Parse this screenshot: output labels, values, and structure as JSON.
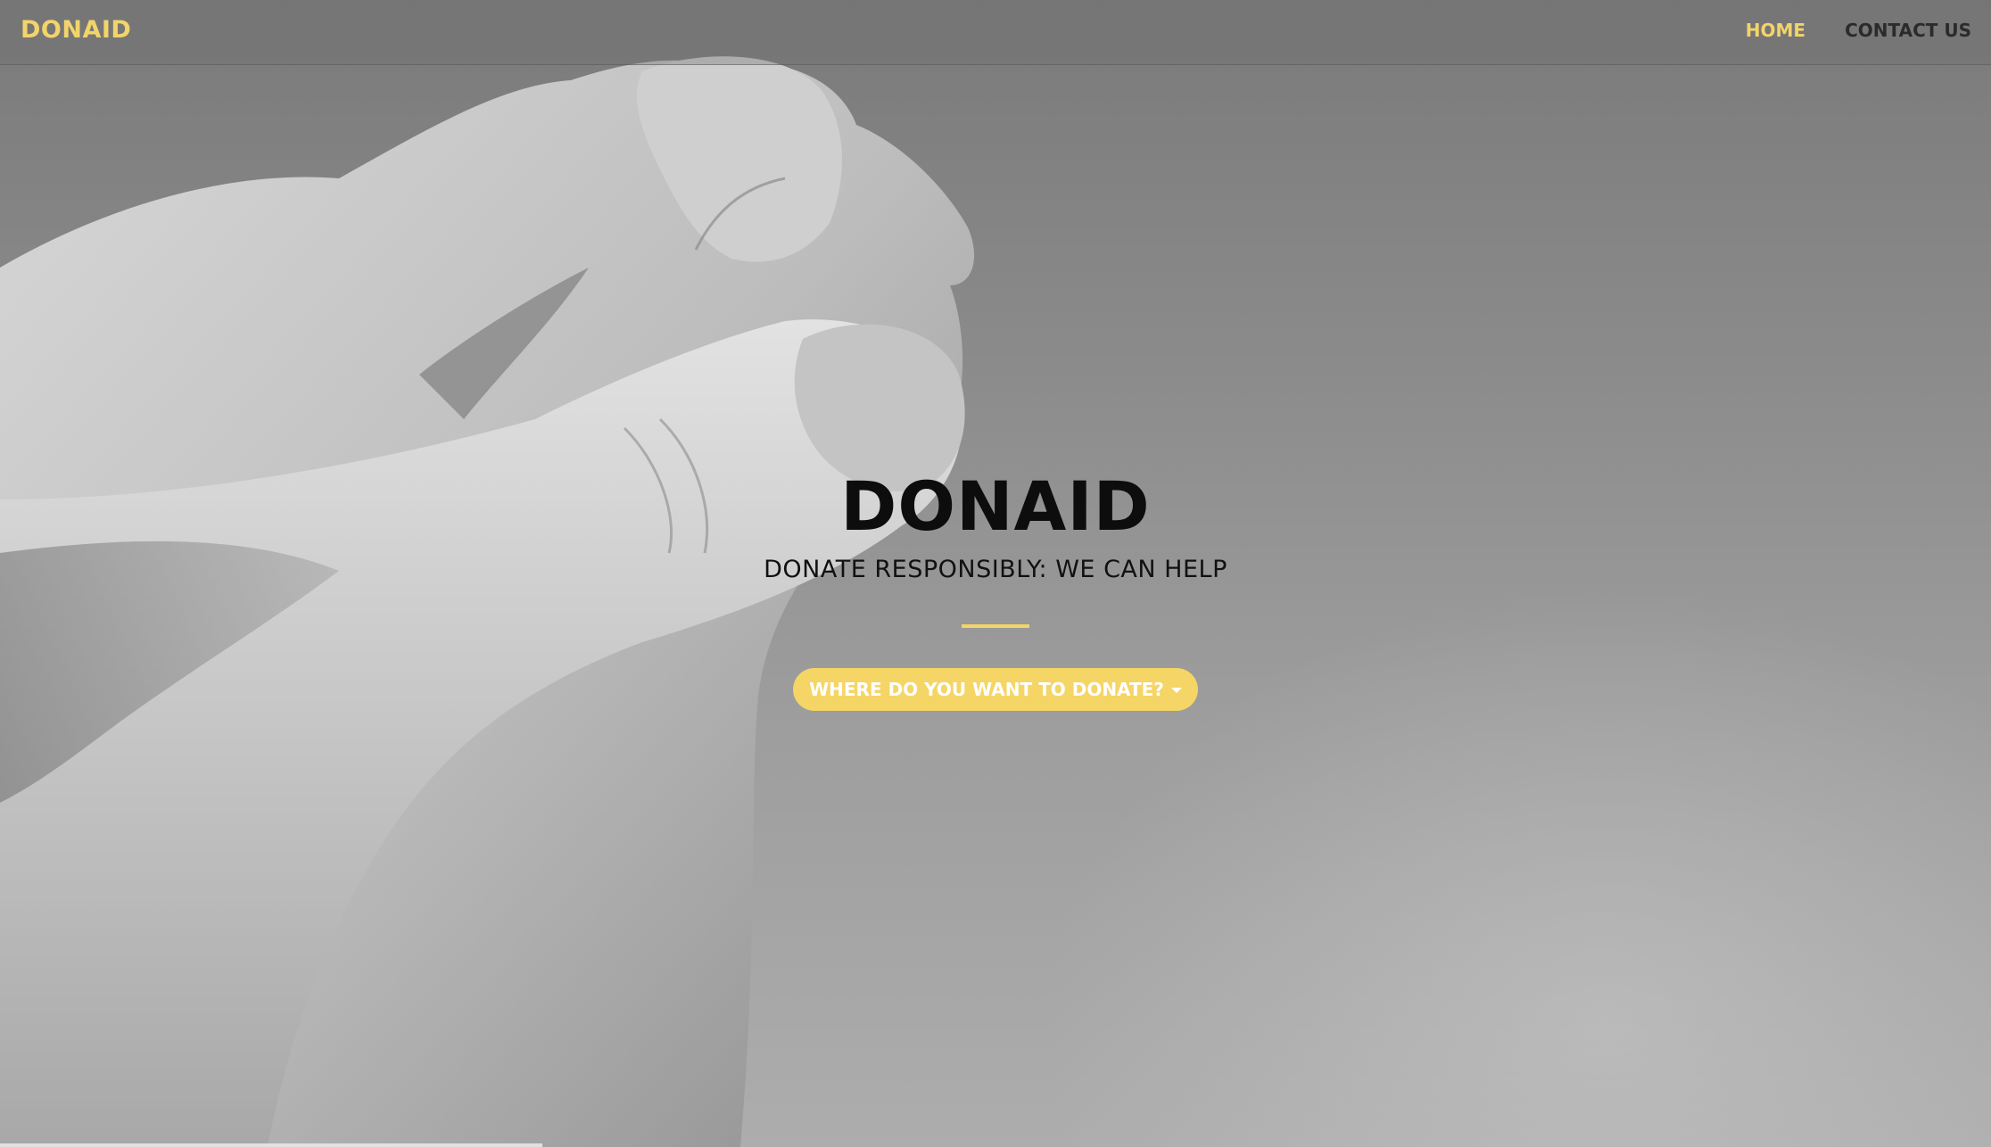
{
  "brand": {
    "name": "DONAID",
    "accent_color": "#f2d46a"
  },
  "nav": {
    "items": [
      {
        "label": "HOME",
        "active": true
      },
      {
        "label": "CONTACT US",
        "active": false
      }
    ]
  },
  "hero": {
    "title": "DONAID",
    "subtitle": "DONATE RESPONSIBLY: WE CAN HELP",
    "background_image": "grayscale-clasped-hands",
    "cta": {
      "label": "WHERE DO YOU WANT TO DONATE?",
      "icon": "caret-down-icon"
    }
  }
}
